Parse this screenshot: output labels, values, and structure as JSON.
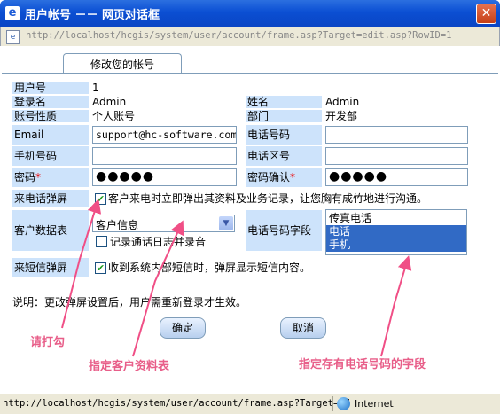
{
  "window": {
    "title": "用户帐号 －－ 网页对话框",
    "address_url": "http://localhost/hcgis/system/user/account/frame.asp?Target=edit.asp?RowID=1",
    "close_label": "✕"
  },
  "tab": {
    "label": "修改您的帐号"
  },
  "form": {
    "user_no_label": "用户号",
    "user_no_value": "1",
    "login_label": "登录名",
    "login_value": "Admin",
    "name_label": "姓名",
    "name_value": "Admin",
    "account_type_label": "账号性质",
    "account_type_value": "个人账号",
    "dept_label": "部门",
    "dept_value": "开发部",
    "email_label": "Email",
    "email_value": "support@hc-software.com",
    "phone_label": "电话号码",
    "phone_value": "",
    "mobile_label": "手机号码",
    "mobile_value": "",
    "area_code_label": "电话区号",
    "area_code_value": "",
    "password_label": "密码",
    "password_value": "●●●●●",
    "confirm_label": "密码确认",
    "confirm_value": "●●●●●",
    "required_mark": "*",
    "popup_label": "来电话弹屏",
    "popup_checked": true,
    "popup_text": "客户来电时立即弹出其资料及业务记录，让您胸有成竹地进行沟通。",
    "customer_table_label": "客户数据表",
    "customer_table_value": "客户信息",
    "record_log_checked": false,
    "record_log_text": "记录通话日志并录音",
    "phone_field_label": "电话号码字段",
    "phone_field_options": [
      {
        "label": "传真电话",
        "selected": false
      },
      {
        "label": "电话",
        "selected": true
      },
      {
        "label": "手机",
        "selected": true
      }
    ],
    "sms_label": "来短信弹屏",
    "sms_checked": true,
    "sms_text": "收到系统内部短信时，弹屏显示短信内容。",
    "note": "说明：更改弹屏设置后，用户需重新登录才生效。",
    "ok_label": "确定",
    "cancel_label": "取消"
  },
  "annotations": {
    "check_hint": "请打勾",
    "table_hint": "指定客户资料表",
    "field_hint": "指定存有电话号码的字段",
    "arrow_color": "#f04f86"
  },
  "statusbar": {
    "url": "http://localhost/hcgis/system/user/account/frame.asp?Target=ed",
    "zone": "Internet"
  }
}
